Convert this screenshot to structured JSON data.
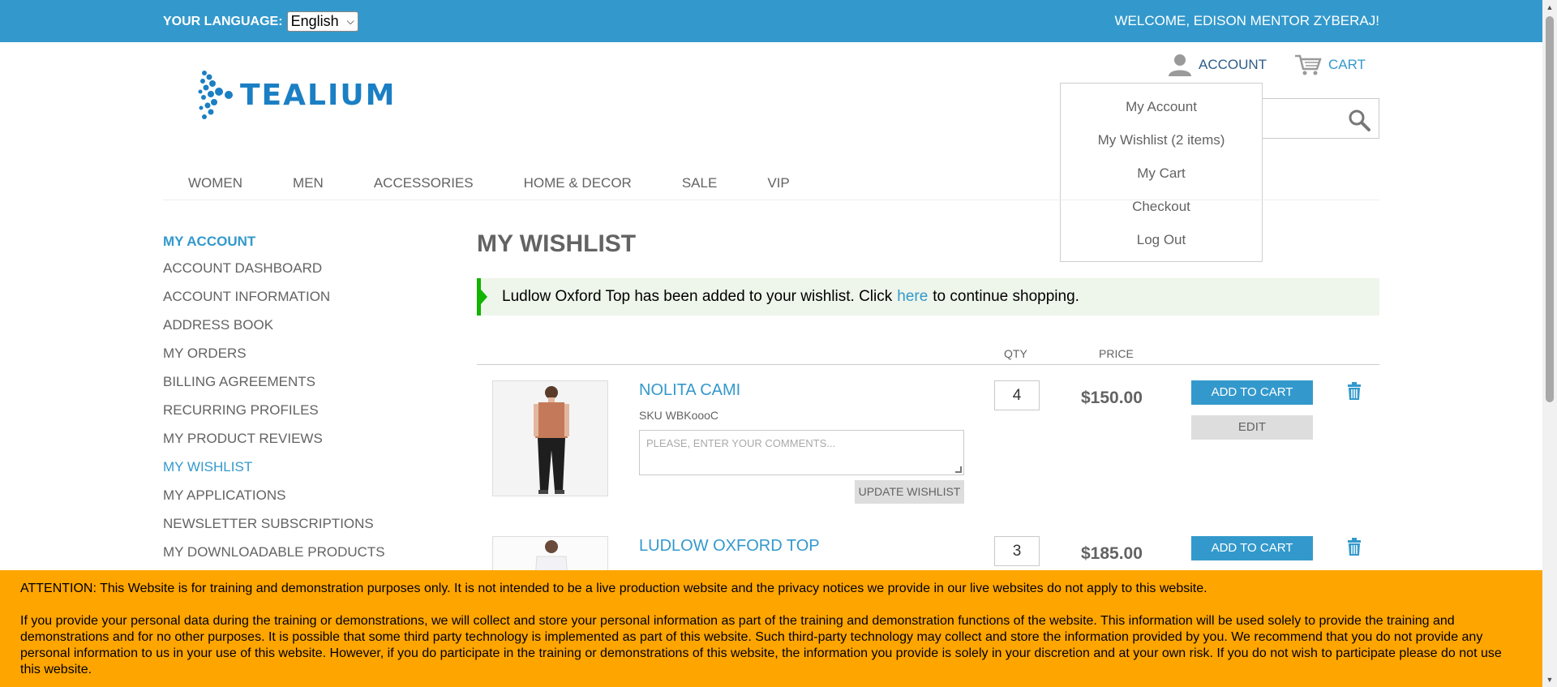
{
  "topbar": {
    "language_label": "YOUR LANGUAGE:",
    "language_value": "English",
    "welcome": "WELCOME, EDISON MENTOR ZYBERAJ!"
  },
  "header": {
    "logo_text": "TEALIUM",
    "account_label": "ACCOUNT",
    "cart_label": "CART"
  },
  "account_menu": {
    "items": [
      "My Account",
      "My Wishlist (2 items)",
      "My Cart",
      "Checkout",
      "Log Out"
    ]
  },
  "nav": {
    "items": [
      "WOMEN",
      "MEN",
      "ACCESSORIES",
      "HOME & DECOR",
      "SALE",
      "VIP"
    ]
  },
  "sidebar": {
    "title": "MY ACCOUNT",
    "items": [
      "ACCOUNT DASHBOARD",
      "ACCOUNT INFORMATION",
      "ADDRESS BOOK",
      "MY ORDERS",
      "BILLING AGREEMENTS",
      "RECURRING PROFILES",
      "MY PRODUCT REVIEWS",
      "MY WISHLIST",
      "MY APPLICATIONS",
      "NEWSLETTER SUBSCRIPTIONS",
      "MY DOWNLOADABLE PRODUCTS"
    ],
    "active": "MY WISHLIST"
  },
  "main": {
    "title": "MY WISHLIST",
    "notice_before": "Ludlow Oxford Top has been added to your wishlist. Click",
    "notice_link": "here",
    "notice_after": "to continue shopping.",
    "col_qty": "QTY",
    "col_price": "PRICE",
    "items": [
      {
        "name": "NOLITA CAMI",
        "sku": "SKU WBKoooC",
        "comment_placeholder": "PLEASE, ENTER YOUR COMMENTS...",
        "update_label": "UPDATE WISHLIST",
        "qty": "4",
        "price": "$150.00",
        "add_label": "ADD TO CART",
        "edit_label": "EDIT"
      },
      {
        "name": "LUDLOW OXFORD TOP",
        "qty": "3",
        "price": "$185.00",
        "add_label": "ADD TO CART"
      }
    ]
  },
  "attention": {
    "p1": "ATTENTION: This Website is for training and demonstration purposes only. It is not intended to be a live production website and the privacy notices we provide in our live websites do not apply to this website.",
    "p2": "If you provide your personal data during the training or demonstrations, we will collect and store your personal information as part of the training and demonstration functions of the website. This information will be used solely to provide the training and demonstrations and for no other purposes. It is possible that some third party technology is implemented as part of this website. Such third-party technology may collect and store the information provided by you. We recommend that you do not provide any personal information to us in your use of this website. However, if you do participate in the training or demonstrations of this website, the information you provide is solely in your discretion and at your own risk. If you do not wish to participate please do not use this website."
  },
  "colors": {
    "topbar": "#3399cc",
    "accent": "#3399cc",
    "notice_border": "#11b400",
    "notice_bg": "#eef5ea",
    "attention_bg": "#ffa500"
  },
  "icons": [
    "user-icon",
    "cart-icon",
    "search-icon",
    "trash-icon",
    "chevron-down-icon"
  ]
}
